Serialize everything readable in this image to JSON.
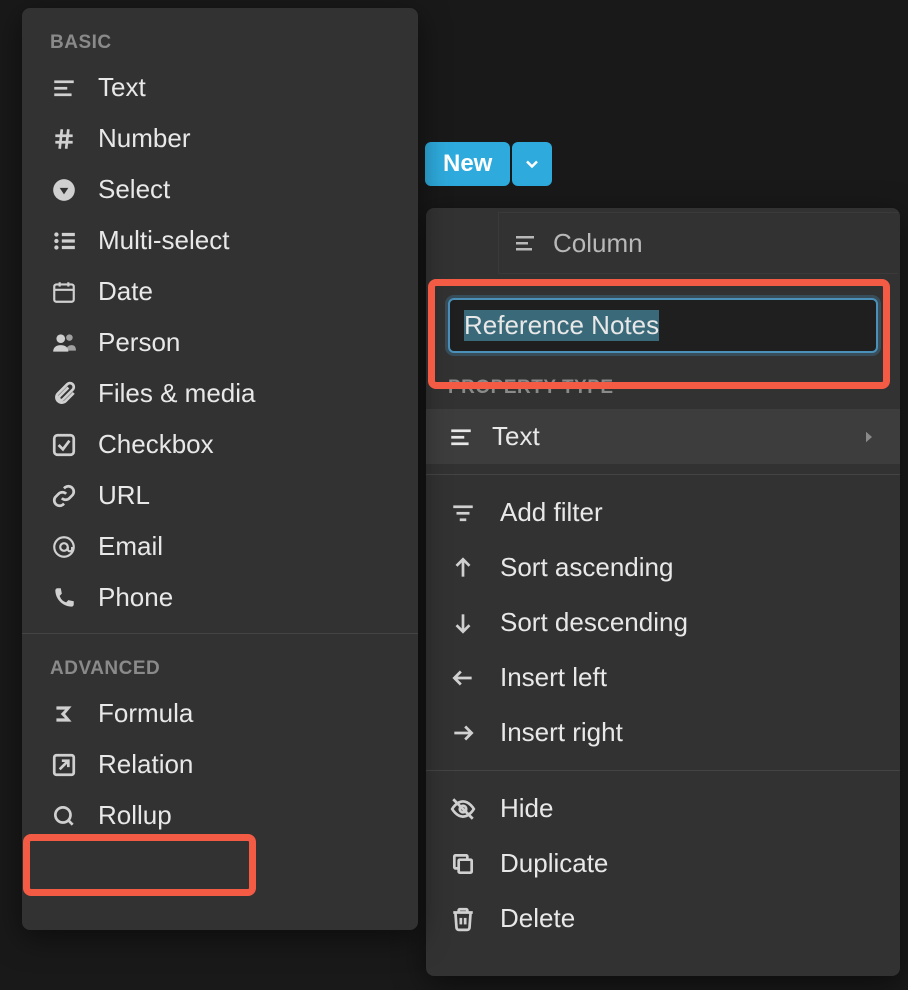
{
  "newButton": {
    "label": "New"
  },
  "columnHeader": {
    "label": "Column"
  },
  "leftMenu": {
    "sections": {
      "basic": "BASIC",
      "advanced": "ADVANCED"
    },
    "basicItems": [
      {
        "label": "Text",
        "icon": "text"
      },
      {
        "label": "Number",
        "icon": "hash"
      },
      {
        "label": "Select",
        "icon": "select"
      },
      {
        "label": "Multi-select",
        "icon": "multiselect"
      },
      {
        "label": "Date",
        "icon": "date"
      },
      {
        "label": "Person",
        "icon": "person"
      },
      {
        "label": "Files & media",
        "icon": "file"
      },
      {
        "label": "Checkbox",
        "icon": "checkbox"
      },
      {
        "label": "URL",
        "icon": "url"
      },
      {
        "label": "Email",
        "icon": "email"
      },
      {
        "label": "Phone",
        "icon": "phone"
      }
    ],
    "advancedItems": [
      {
        "label": "Formula",
        "icon": "formula"
      },
      {
        "label": "Relation",
        "icon": "relation"
      },
      {
        "label": "Rollup",
        "icon": "rollup"
      }
    ]
  },
  "rightMenu": {
    "nameInput": "Reference Notes",
    "propTypeLabel": "PROPERTY TYPE",
    "currentType": "Text",
    "actions": [
      {
        "label": "Add filter",
        "icon": "filter"
      },
      {
        "label": "Sort ascending",
        "icon": "arrow-up"
      },
      {
        "label": "Sort descending",
        "icon": "arrow-down"
      },
      {
        "label": "Insert left",
        "icon": "arrow-left"
      },
      {
        "label": "Insert right",
        "icon": "arrow-right"
      },
      {
        "label": "Hide",
        "icon": "hide"
      },
      {
        "label": "Duplicate",
        "icon": "duplicate"
      },
      {
        "label": "Delete",
        "icon": "delete"
      }
    ]
  }
}
